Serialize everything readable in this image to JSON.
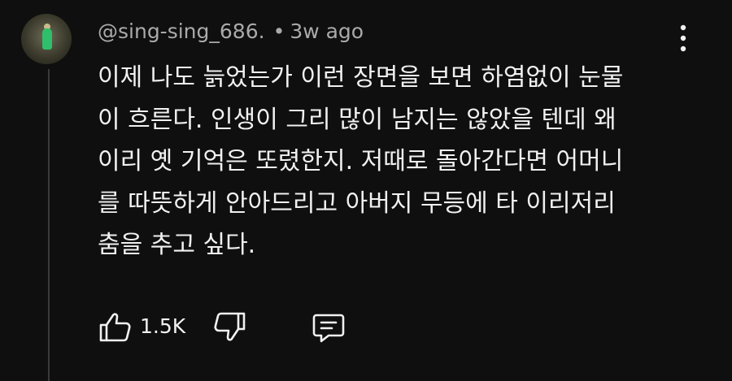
{
  "comment": {
    "author": "@sing-sing_686.",
    "separator": "•",
    "time": "3w ago",
    "text": "이제 나도 늙었는가 이런 장면을 보면 하염없이 눈물\n이 흐른다. 인생이 그리 많이 남지는 않았을 텐데 왜\n이리 옛 기억은 또렸한지. 저때로 돌아간다면 어머니\n를 따뜻하게 안아드리고 아버지 무등에 타 이리저리\n춤을 추고 싶다.",
    "like_count": "1.5K"
  },
  "icons": {
    "avatar": "user-avatar",
    "more": "kebab-menu-icon",
    "like": "thumbs-up-icon",
    "dislike": "thumbs-down-icon",
    "reply": "reply-comment-icon"
  },
  "colors": {
    "background": "#0f0f0f",
    "text": "#f1f1f1",
    "meta": "#aaaaaa"
  }
}
